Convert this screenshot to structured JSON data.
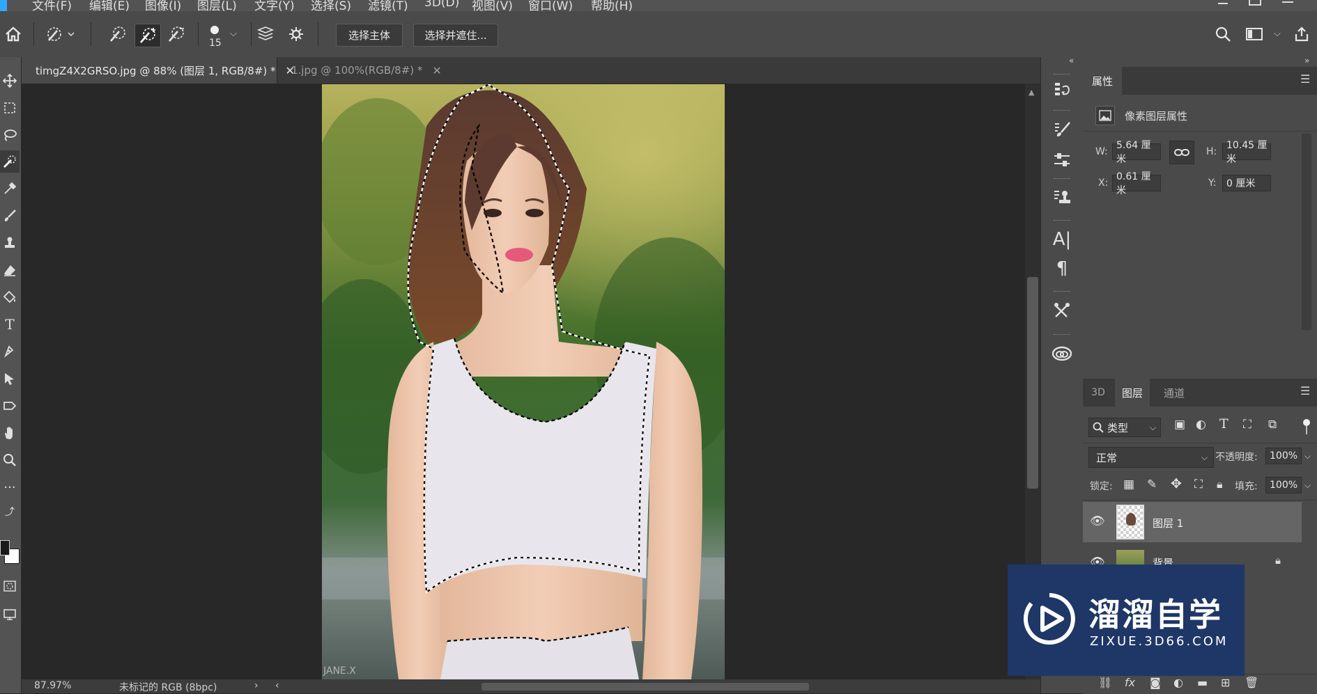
{
  "menubar": {
    "items": [
      "文件(F)",
      "编辑(E)",
      "图像(I)",
      "图层(L)",
      "文字(Y)",
      "选择(S)",
      "滤镜(T)",
      "3D(D)",
      "视图(V)",
      "窗口(W)",
      "帮助(H)"
    ]
  },
  "options": {
    "brush_size": "15",
    "select_subject_label": "选择主体",
    "select_and_mask_label": "选择并遮住..."
  },
  "tabs": [
    {
      "label": "timgZ4X2GRSO.jpg @ 88% (图层 1, RGB/8#) *",
      "active": true
    },
    {
      "label": "1.jpg @ 100%(RGB/8#) *",
      "active": false
    }
  ],
  "tools": {
    "names": [
      "move-tool-icon",
      "marquee-tool-icon",
      "lasso-tool-icon",
      "quick-selection-tool-icon",
      "eyedropper-tool-icon",
      "brush-tool-icon",
      "stamp-tool-icon",
      "eraser-tool-icon",
      "paint-bucket-tool-icon",
      "type-tool-icon",
      "pen-tool-icon",
      "path-selection-tool-icon",
      "shape-tool-icon",
      "hand-tool-icon",
      "zoom-tool-icon",
      "more-tools-icon"
    ],
    "foreground_color": "#1a1a1a",
    "background_color": "#ffffff"
  },
  "status": {
    "zoom": "87.97%",
    "profile": "未标记的 RGB (8bpc)"
  },
  "properties_panel": {
    "tab_label": "属性",
    "section_title": "像素图层属性",
    "w_label": "W:",
    "w_value": "5.64 厘米",
    "h_label": "H:",
    "h_value": "10.45 厘米",
    "x_label": "X:",
    "x_value": "0.61 厘米",
    "y_label": "Y:",
    "y_value": "0 厘米"
  },
  "layers_panel": {
    "tabs": [
      "3D",
      "图层",
      "通道"
    ],
    "active_tab": "图层",
    "filter_label": "类型",
    "blend_mode": "正常",
    "opacity_label": "不透明度:",
    "opacity_value": "100%",
    "lock_label": "锁定:",
    "fill_label": "填充:",
    "fill_value": "100%",
    "layers": [
      {
        "name": "图层 1",
        "visible": true,
        "selected": true,
        "locked": false
      },
      {
        "name": "背景",
        "visible": true,
        "selected": false,
        "locked": true
      }
    ]
  },
  "photo": {
    "watermark_text": "JANE.X"
  },
  "watermark": {
    "title": "溜溜自学",
    "url": "ZIXUE.3D66.COM"
  }
}
